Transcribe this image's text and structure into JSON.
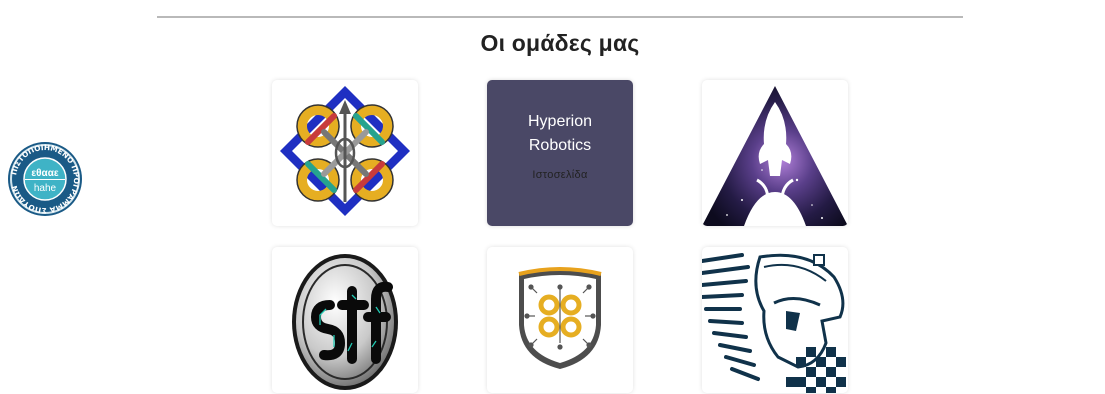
{
  "section": {
    "title": "Οι ομάδες μας"
  },
  "badge": {
    "ring_text": "ΠΙΣΤΟΠΟΙΗΜΕΝΟ ΠΡΟΓΡΑΜΜΑ ΣΠΟΥΔΩΝ",
    "greek_label": "εθααε",
    "latin_label": "hahe"
  },
  "teams": [
    {
      "logo": "university-knot-logo"
    },
    {
      "name_line1": "Hyperion",
      "name_line2": "Robotics",
      "link_text": "Ιστοσελίδα"
    },
    {
      "logo": "galaxy-rocket-logo"
    },
    {
      "logo": "stf-circuit-logo"
    },
    {
      "logo": "shield-knot-circuit-logo"
    },
    {
      "logo": "spartan-helmet-logo"
    }
  ],
  "colors": {
    "hover_overlay": "#4a4866",
    "divider": "#b9b9b9",
    "badge_blue": "#1a5a86",
    "badge_teal": "#3fb3c6"
  }
}
